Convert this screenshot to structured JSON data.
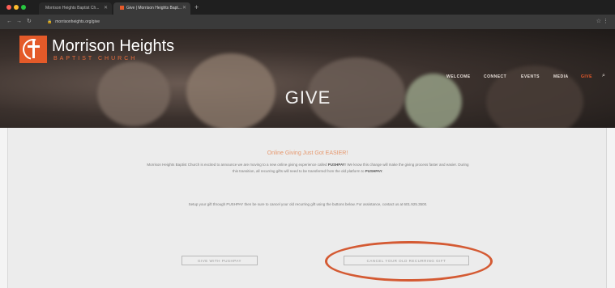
{
  "browser": {
    "tabs": [
      {
        "label": "Morrison Heights Baptist Ch..."
      },
      {
        "label": "Give | Morrison Heights Bapt..."
      }
    ],
    "url": "morrisonheights.org/give"
  },
  "site": {
    "logo": {
      "name": "Morrison Heights",
      "subtitle": "BAPTIST CHURCH"
    },
    "nav": [
      "WELCOME",
      "CONNECT",
      "EVENTS",
      "MEDIA",
      "GIVE"
    ],
    "hero_title": "GIVE"
  },
  "content": {
    "heading": "Online Giving Just Got EASIER!",
    "para1_a": "Morrison Heights Baptist Church is excited to announce we are moving to a new online giving experience called ",
    "pushpay1": "PUSHPAY",
    "para1_b": "! We know this change will make the giving process faster and easier. During this transition, all recurring gifts will need to be transferred from the old platform to ",
    "pushpay2": "PUSHPAY",
    "para1_c": ".",
    "para2": "Setup your gift through PUSHPAY then be sure to cancel your old recurring gift using the buttons below. For assistance, contact us at 601.925.3500.",
    "btn_give": "GIVE WITH PUSHPAY",
    "btn_cancel": "CANCEL YOUR OLD RECURRING GIFT"
  },
  "colors": {
    "accent": "#e45a29",
    "annotation": "#d45a33"
  }
}
